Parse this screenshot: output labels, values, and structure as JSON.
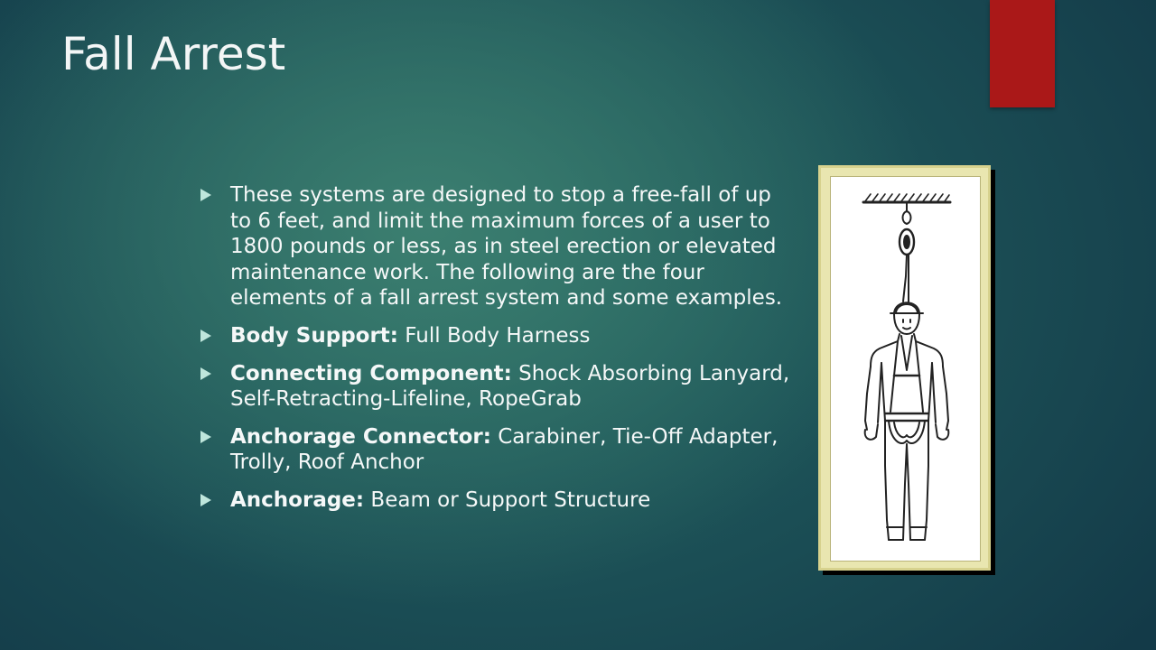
{
  "slide": {
    "title": "Fall Arrest"
  },
  "bullets": [
    {
      "lead": "",
      "text": "These systems are designed to stop a free-fall of up to 6 feet, and limit the maximum forces of a user to 1800 pounds or less, as in steel erection or elevated maintenance work. The following are the four elements of a fall arrest system and some examples."
    },
    {
      "lead": "Body Support:",
      "text": " Full Body Harness"
    },
    {
      "lead": "Connecting Component:",
      "text": " Shock Absorbing Lanyard, Self-Retracting-Lifeline, RopeGrab"
    },
    {
      "lead": "Anchorage Connector:",
      "text": " Carabiner, Tie-Off Adapter, Trolly, Roof Anchor"
    },
    {
      "lead": "Anchorage:",
      "text": " Beam or Support Structure"
    }
  ],
  "figure": {
    "icon": "suspended-worker-harness-illustration"
  },
  "colors": {
    "accent_tab": "#aa1818",
    "bullet_marker": "#bfe6dc",
    "frame": "#e9e6b0"
  }
}
